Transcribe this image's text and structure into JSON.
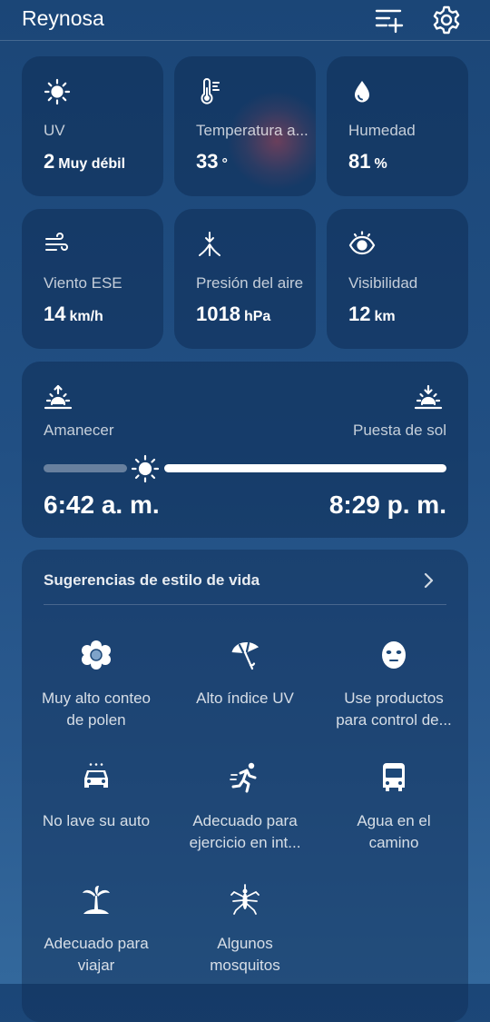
{
  "header": {
    "city": "Reynosa",
    "add_icon": "add-location-icon",
    "settings_icon": "gear-icon"
  },
  "tiles": [
    {
      "icon": "sun-icon",
      "label": "UV",
      "value": "2",
      "unit": "Muy débil"
    },
    {
      "icon": "thermometer-icon",
      "label": "Temperatura a...",
      "value": "33",
      "unit": "°"
    },
    {
      "icon": "droplet-icon",
      "label": "Humedad",
      "value": "81",
      "unit": "%"
    },
    {
      "icon": "wind-icon",
      "label": "Viento ESE",
      "value": "14",
      "unit": "km/h"
    },
    {
      "icon": "pressure-icon",
      "label": "Presión del aire",
      "value": "1018",
      "unit": "hPa"
    },
    {
      "icon": "eye-icon",
      "label": "Visibilidad",
      "value": "12",
      "unit": "km"
    }
  ],
  "sun": {
    "sunrise_label": "Amanecer",
    "sunset_label": "Puesta de sol",
    "sunrise_time": "6:42 a. m.",
    "sunset_time": "8:29 p. m.",
    "progress": 0.23
  },
  "lifestyle": {
    "title": "Sugerencias de estilo de vida",
    "items": [
      {
        "icon": "pollen-flower-icon",
        "line1": "Muy alto conteo",
        "line2": "de polen"
      },
      {
        "icon": "umbrella-icon",
        "line1": "Alto índice UV",
        "line2": ""
      },
      {
        "icon": "face-mask-icon",
        "line1": "Use productos",
        "line2": "para control de..."
      },
      {
        "icon": "car-icon",
        "line1": "No lave su auto",
        "line2": ""
      },
      {
        "icon": "runner-icon",
        "line1": "Adecuado para",
        "line2": "ejercicio en int..."
      },
      {
        "icon": "bus-icon",
        "line1": "Agua en el",
        "line2": "camino"
      },
      {
        "icon": "palm-island-icon",
        "line1": "Adecuado para",
        "line2": "viajar"
      },
      {
        "icon": "mosquito-icon",
        "line1": "Algunos",
        "line2": "mosquitos"
      }
    ]
  }
}
